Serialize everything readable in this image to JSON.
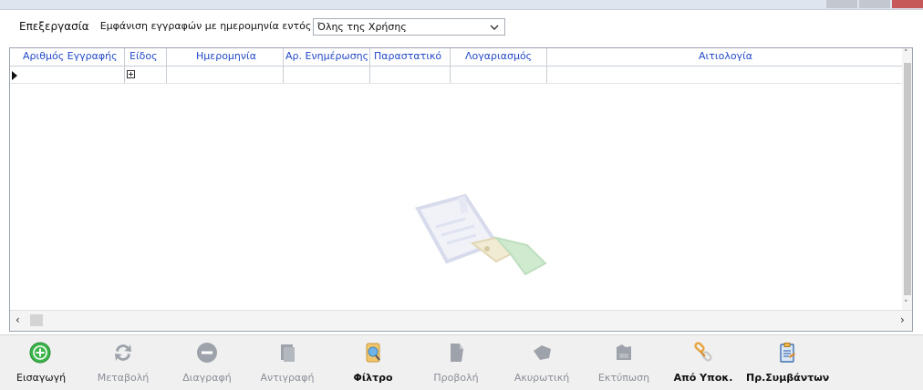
{
  "toolbar": {
    "menu_label": "Επεξεργασία",
    "date_filter_label": "Εμφάνιση εγγραφών με ημερομηνία εντός",
    "date_filter_value": "Όλης της Χρήσης"
  },
  "grid": {
    "columns": [
      "Αριθμός Εγγραφής",
      "Είδος",
      "Ημερομηνία",
      "Αρ. Ενημέρωσης",
      "Παραστατικό",
      "Λογαριασμός",
      "Αιτιολογία"
    ]
  },
  "actions": [
    {
      "label": "Εισαγωγή",
      "enabled": true
    },
    {
      "label": "Μεταβολή",
      "enabled": false
    },
    {
      "label": "Διαγραφή",
      "enabled": false
    },
    {
      "label": "Αντιγραφή",
      "enabled": false
    },
    {
      "label": "Φίλτρο",
      "enabled": true
    },
    {
      "label": "Προβολή",
      "enabled": false
    },
    {
      "label": "Ακυρωτική",
      "enabled": false
    },
    {
      "label": "Εκτύπωση",
      "enabled": false
    },
    {
      "label": "Από Υποκ.",
      "enabled": true
    },
    {
      "label": "Πρ.Συμβάντων",
      "enabled": true
    }
  ],
  "colors": {
    "header_text": "#2349c8",
    "add_green": "#3bb54a",
    "disabled_gray": "#8b8f98"
  }
}
